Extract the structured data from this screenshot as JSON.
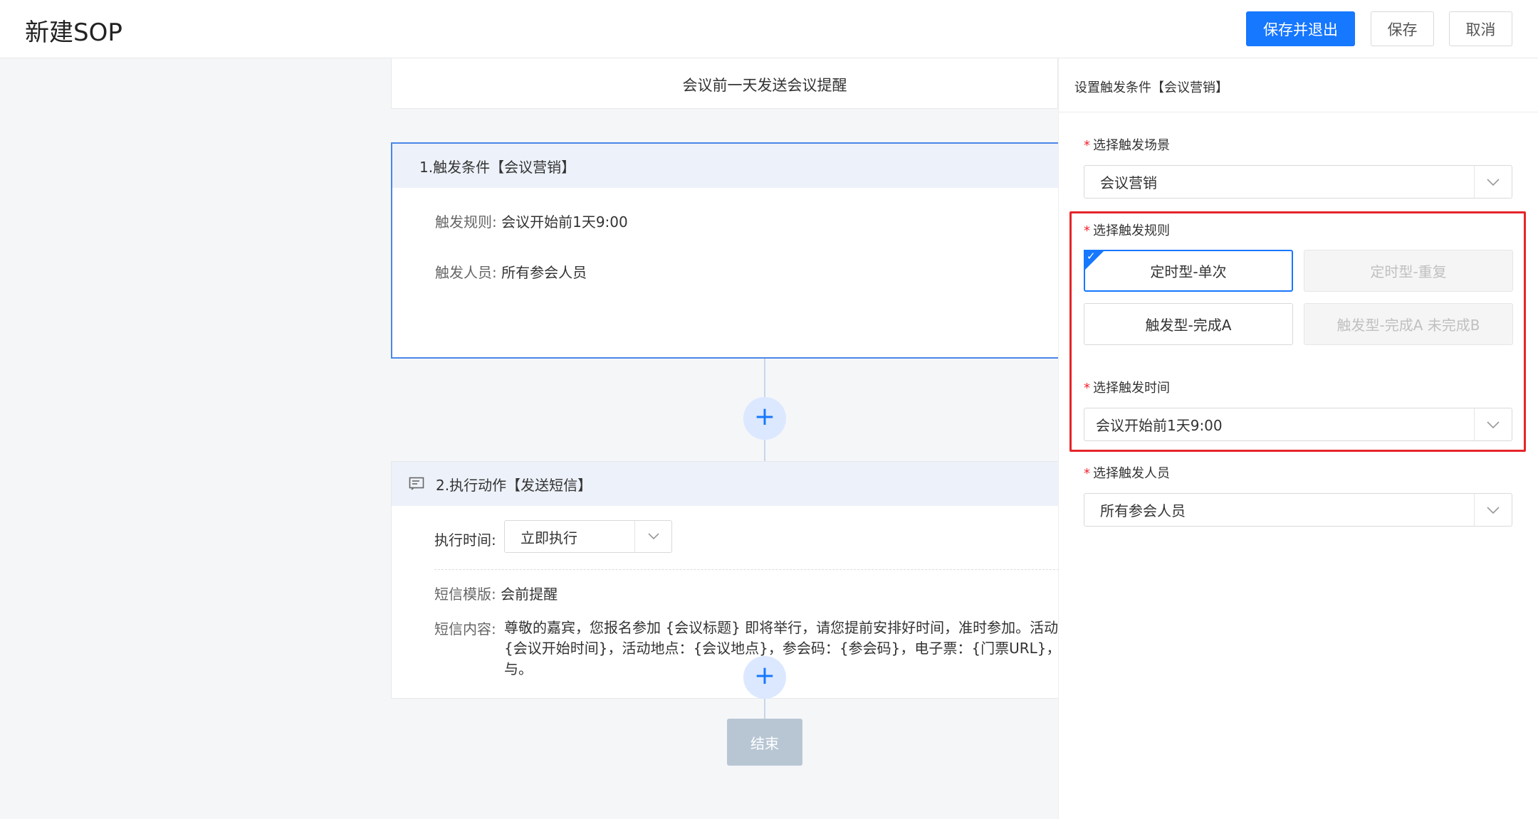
{
  "header": {
    "title": "新建SOP",
    "save_exit_label": "保存并退出",
    "save_label": "保存",
    "cancel_label": "取消"
  },
  "canvas": {
    "sop_name": "会议前一天发送会议提醒",
    "trigger_card": {
      "title": "1.触发条件【会议营销】",
      "rule_label": "触发规则:",
      "rule_value": "会议开始前1天9:00",
      "people_label": "触发人员:",
      "people_value": "所有参会人员"
    },
    "action_card": {
      "title": "2.执行动作【发送短信】",
      "time_label": "执行时间:",
      "time_value": "立即执行",
      "template_label": "短信模版:",
      "template_value": "会前提醒",
      "content_label": "短信内容:",
      "content_line1": "尊敬的嘉宾，您报名参加 {会议标题} 即将举行，请您提前安排好时间，准时参加。活动时间",
      "content_line2": "{会议开始时间}，活动地点：{会议地点}，参会码：{参会码}，电子票：{门票URL}，感谢您",
      "content_line3": "与。"
    },
    "add_symbol": "+",
    "end_label": "结束"
  },
  "panel": {
    "title": "设置触发条件【会议营销】",
    "required_mark": "*",
    "scene_label": "选择触发场景",
    "scene_value": "会议营销",
    "rule_label": "选择触发规则",
    "rules": [
      {
        "label": "定时型-单次",
        "state": "selected"
      },
      {
        "label": "定时型-重复",
        "state": "disabled"
      },
      {
        "label": "触发型-完成A",
        "state": "normal"
      },
      {
        "label": "触发型-完成A 未完成B",
        "state": "disabled"
      }
    ],
    "time_label": "选择触发时间",
    "time_value": "会议开始前1天9:00",
    "people_label": "选择触发人员",
    "people_value": "所有参会人员"
  },
  "colors": {
    "primary": "#1677ff",
    "highlight": "#e5252a",
    "required": "#f5222d"
  }
}
